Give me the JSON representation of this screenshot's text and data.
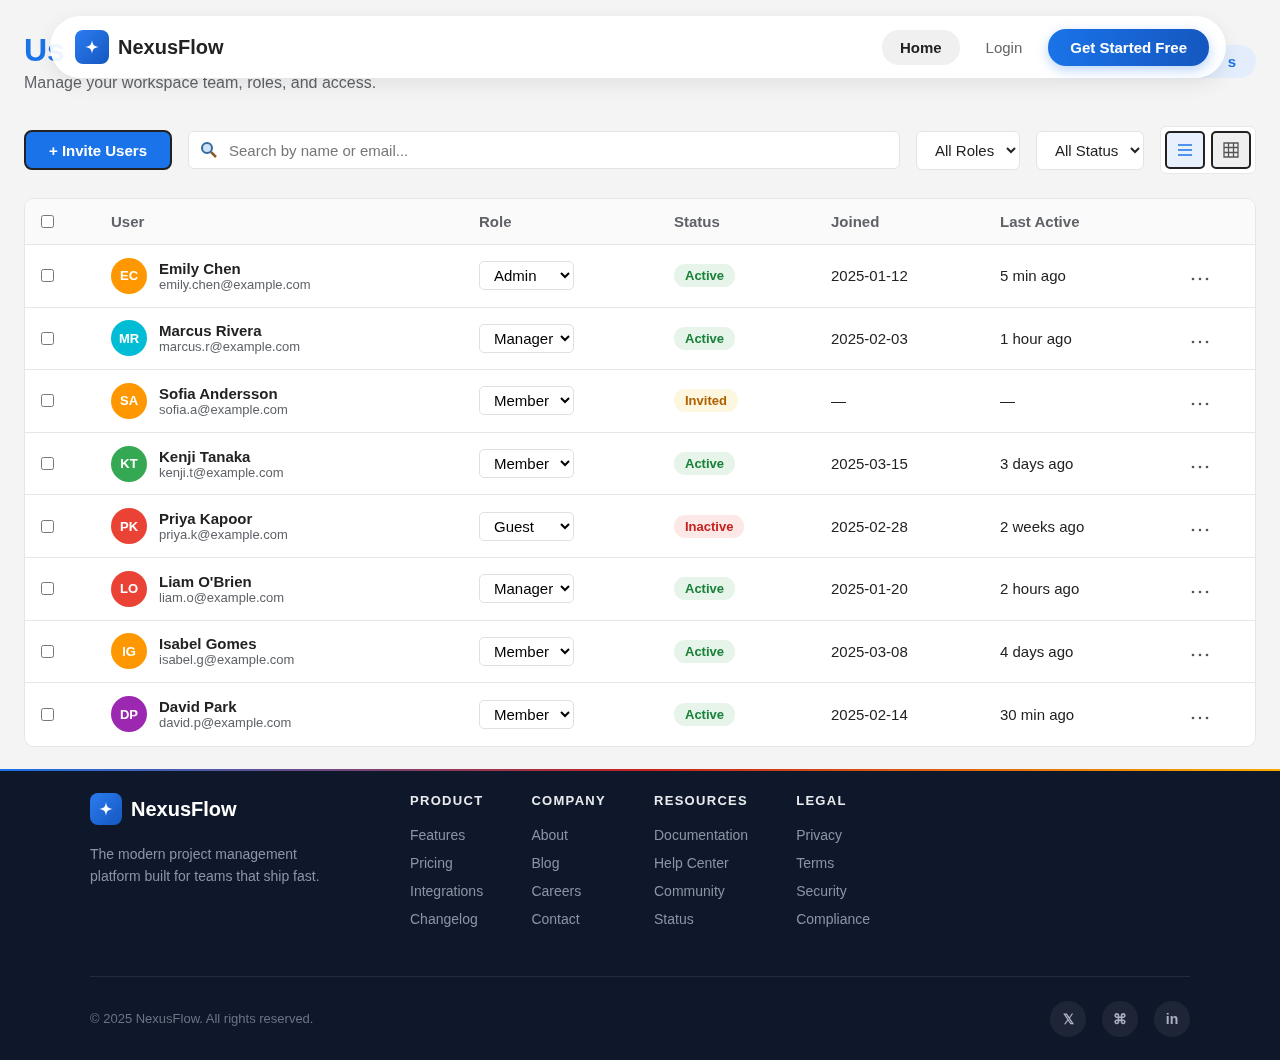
{
  "nav": {
    "brand": "NexusFlow",
    "links": [
      {
        "label": "Home",
        "selected": true
      },
      {
        "label": "Login",
        "selected": false
      }
    ],
    "cta": "Get Started Free"
  },
  "page": {
    "title": "Us",
    "subtitle": "Manage your workspace team, roles, and access.",
    "badge": "s"
  },
  "toolbar": {
    "invite": "+ Invite Users",
    "search": {
      "placeholder": "Search by name or email..."
    },
    "filters": [
      "All Roles",
      "All Status"
    ],
    "views": [
      {
        "kind": "list",
        "selected": true
      },
      {
        "kind": "grid",
        "selected": false
      }
    ]
  },
  "table": {
    "select_all": {
      "checked": false
    },
    "columns": [
      "User",
      "Role",
      "Status",
      "Joined",
      "Last Active"
    ],
    "rows": [
      {
        "selected": false,
        "initials": "EC",
        "color": "#ff9800",
        "name": "Emily Chen",
        "email": "emily.chen@example.com",
        "role": "Admin",
        "status": {
          "kind": "active",
          "label": "Active"
        },
        "joined": "2025-01-12",
        "last_active": "5 min ago"
      },
      {
        "selected": false,
        "initials": "MR",
        "color": "#00bcd4",
        "name": "Marcus Rivera",
        "email": "marcus.r@example.com",
        "role": "Manager",
        "status": {
          "kind": "active",
          "label": "Active"
        },
        "joined": "2025-02-03",
        "last_active": "1 hour ago"
      },
      {
        "selected": false,
        "initials": "SA",
        "color": "#ff9800",
        "name": "Sofia Andersson",
        "email": "sofia.a@example.com",
        "role": "Member",
        "status": {
          "kind": "invited",
          "label": "Invited"
        },
        "joined": "—",
        "last_active": "—"
      },
      {
        "selected": false,
        "initials": "KT",
        "color": "#34a853",
        "name": "Kenji Tanaka",
        "email": "kenji.t@example.com",
        "role": "Member",
        "status": {
          "kind": "active",
          "label": "Active"
        },
        "joined": "2025-03-15",
        "last_active": "3 days ago"
      },
      {
        "selected": false,
        "initials": "PK",
        "color": "#ea4335",
        "name": "Priya Kapoor",
        "email": "priya.k@example.com",
        "role": "Guest",
        "status": {
          "kind": "inactive",
          "label": "Inactive"
        },
        "joined": "2025-02-28",
        "last_active": "2 weeks ago"
      },
      {
        "selected": false,
        "initials": "LO",
        "color": "#ea4335",
        "name": "Liam O'Brien",
        "email": "liam.o@example.com",
        "role": "Manager",
        "status": {
          "kind": "active",
          "label": "Active"
        },
        "joined": "2025-01-20",
        "last_active": "2 hours ago"
      },
      {
        "selected": false,
        "initials": "IG",
        "color": "#ff9800",
        "name": "Isabel Gomes",
        "email": "isabel.g@example.com",
        "role": "Member",
        "status": {
          "kind": "active",
          "label": "Active"
        },
        "joined": "2025-03-08",
        "last_active": "4 days ago"
      },
      {
        "selected": false,
        "initials": "DP",
        "color": "#9c27b0",
        "name": "David Park",
        "email": "david.p@example.com",
        "role": "Member",
        "status": {
          "kind": "active",
          "label": "Active"
        },
        "joined": "2025-02-14",
        "last_active": "30 min ago"
      }
    ]
  },
  "footer": {
    "brand": "NexusFlow",
    "tagline": "The modern project management platform built for teams that ship fast.",
    "columns": [
      {
        "heading": "PRODUCT",
        "links": [
          "Features",
          "Pricing",
          "Integrations",
          "Changelog"
        ]
      },
      {
        "heading": "COMPANY",
        "links": [
          "About",
          "Blog",
          "Careers",
          "Contact"
        ]
      },
      {
        "heading": "RESOURCES",
        "links": [
          "Documentation",
          "Help Center",
          "Community",
          "Status"
        ]
      },
      {
        "heading": "LEGAL",
        "links": [
          "Privacy",
          "Terms",
          "Security",
          "Compliance"
        ]
      }
    ],
    "copyright": "© 2025 NexusFlow. All rights reserved.",
    "social": [
      "𝕏",
      "⌘",
      "in"
    ]
  }
}
